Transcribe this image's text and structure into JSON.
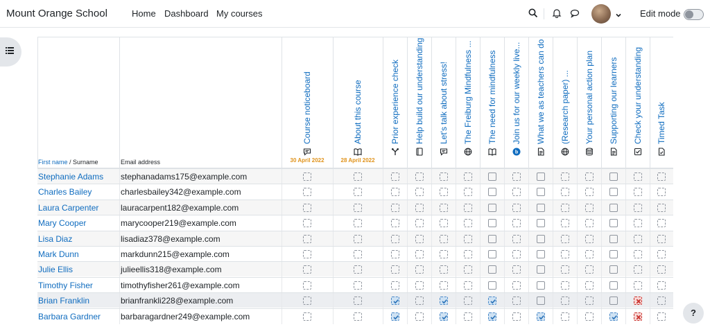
{
  "navbar": {
    "brand": "Mount Orange School",
    "links": [
      "Home",
      "Dashboard",
      "My courses"
    ],
    "edit_mode_label": "Edit mode",
    "icons": [
      "search-icon",
      "bell-icon",
      "chat-icon",
      "avatar",
      "chevron-down-icon"
    ]
  },
  "table": {
    "first_name_label": "First name",
    "surname_label": "Surname",
    "name_separator": " / ",
    "email_label": "Email address",
    "activities": [
      {
        "name": "Course noticeboard",
        "icon": "forum-icon",
        "date": "30 April 2022"
      },
      {
        "name": "About this course",
        "icon": "book-icon",
        "date": "28 April 2022"
      },
      {
        "name": "Prior experience check",
        "icon": "choice-icon",
        "date": ""
      },
      {
        "name": "Help build our understanding",
        "icon": "database-icon",
        "date": ""
      },
      {
        "name": "Let's talk about stress!",
        "icon": "forum-icon",
        "date": ""
      },
      {
        "name": "The Freiburg Mindfulness ...",
        "icon": "url-icon",
        "date": ""
      },
      {
        "name": "The need for mindfulness",
        "icon": "book-icon",
        "date": ""
      },
      {
        "name": "Join us for our weekly live...",
        "icon": "bigbluebutton-icon",
        "date": ""
      },
      {
        "name": "What we as teachers can do",
        "icon": "page-icon",
        "date": ""
      },
      {
        "name": "(Research paper) ...",
        "icon": "url-icon",
        "date": ""
      },
      {
        "name": "Your personal action plan",
        "icon": "lesson-icon",
        "date": ""
      },
      {
        "name": "Supporting our learners",
        "icon": "page-icon",
        "date": ""
      },
      {
        "name": "Check your understanding",
        "icon": "quiz-icon",
        "date": ""
      },
      {
        "name": "Timed Task",
        "icon": "assignment-icon",
        "date": ""
      }
    ],
    "students": [
      {
        "name": "Stephanie Adams",
        "email": "stephanadams175@example.com",
        "status": [
          "a",
          "a",
          "a",
          "a",
          "a",
          "a",
          "m",
          "a",
          "m",
          "a",
          "a",
          "m",
          "a",
          "a"
        ]
      },
      {
        "name": "Charles Bailey",
        "email": "charlesbailey342@example.com",
        "status": [
          "a",
          "a",
          "a",
          "a",
          "a",
          "a",
          "m",
          "a",
          "m",
          "a",
          "a",
          "m",
          "a",
          "a"
        ]
      },
      {
        "name": "Laura Carpenter",
        "email": "lauracarpent182@example.com",
        "status": [
          "a",
          "a",
          "a",
          "a",
          "a",
          "a",
          "m",
          "a",
          "m",
          "a",
          "a",
          "m",
          "a",
          "a"
        ]
      },
      {
        "name": "Mary Cooper",
        "email": "marycooper219@example.com",
        "status": [
          "a",
          "a",
          "a",
          "a",
          "a",
          "a",
          "m",
          "a",
          "m",
          "a",
          "a",
          "m",
          "a",
          "a"
        ]
      },
      {
        "name": "Lisa Diaz",
        "email": "lisadiaz378@example.com",
        "status": [
          "a",
          "a",
          "a",
          "a",
          "a",
          "a",
          "m",
          "a",
          "m",
          "a",
          "a",
          "m",
          "a",
          "a"
        ]
      },
      {
        "name": "Mark Dunn",
        "email": "markdunn215@example.com",
        "status": [
          "a",
          "a",
          "a",
          "a",
          "a",
          "a",
          "m",
          "a",
          "m",
          "a",
          "a",
          "m",
          "a",
          "a"
        ]
      },
      {
        "name": "Julie Ellis",
        "email": "julieellis318@example.com",
        "status": [
          "a",
          "a",
          "a",
          "a",
          "a",
          "a",
          "m",
          "a",
          "m",
          "a",
          "a",
          "m",
          "a",
          "a"
        ]
      },
      {
        "name": "Timothy Fisher",
        "email": "timothyfisher261@example.com",
        "status": [
          "a",
          "a",
          "a",
          "a",
          "a",
          "a",
          "m",
          "a",
          "m",
          "a",
          "a",
          "m",
          "a",
          "a"
        ]
      },
      {
        "name": "Brian Franklin",
        "email": "brianfrankli228@example.com",
        "status": [
          "a",
          "a",
          "d",
          "a",
          "d",
          "a",
          "d",
          "a",
          "m",
          "a",
          "a",
          "m",
          "f",
          "a"
        ]
      },
      {
        "name": "Barbara Gardner",
        "email": "barbaragardner249@example.com",
        "status": [
          "a",
          "a",
          "d",
          "a",
          "d",
          "a",
          "d",
          "a",
          "d",
          "a",
          "a",
          "d",
          "f",
          "a"
        ]
      }
    ]
  },
  "colors": {
    "link": "#0f6cbf",
    "date": "#e0931b",
    "complete_bg": "#cfe2f3",
    "fail": "#c9302c"
  },
  "help_label": "?"
}
